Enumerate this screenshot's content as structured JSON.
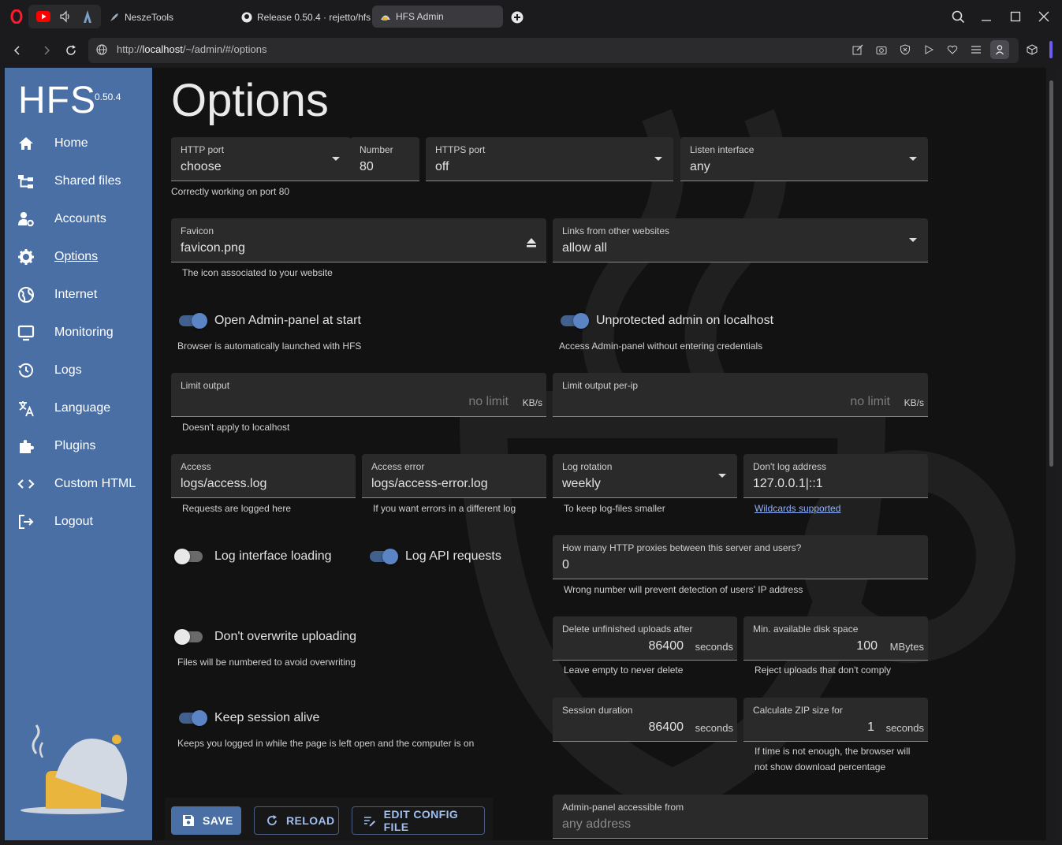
{
  "browser": {
    "tabs": [
      {
        "label": "NeszeTools"
      },
      {
        "label": "Release 0.50.4 · rejetto/hfs"
      },
      {
        "label": "HFS Admin"
      }
    ],
    "url_host": "localhost",
    "url_prefix": "http://",
    "url_path": "/~/admin/#/options"
  },
  "sidebar": {
    "brand": "HFS",
    "version": "0.50.4",
    "items": [
      {
        "label": "Home",
        "icon": "home-icon"
      },
      {
        "label": "Shared files",
        "icon": "tree-icon"
      },
      {
        "label": "Accounts",
        "icon": "user-gear-icon"
      },
      {
        "label": "Options",
        "icon": "gear-icon"
      },
      {
        "label": "Internet",
        "icon": "globe-icon"
      },
      {
        "label": "Monitoring",
        "icon": "monitor-icon"
      },
      {
        "label": "Logs",
        "icon": "history-icon"
      },
      {
        "label": "Language",
        "icon": "translate-icon"
      },
      {
        "label": "Plugins",
        "icon": "puzzle-icon"
      },
      {
        "label": "Custom HTML",
        "icon": "code-icon"
      },
      {
        "label": "Logout",
        "icon": "logout-icon"
      }
    ]
  },
  "page": {
    "title": "Options",
    "http_port": {
      "label": "HTTP port",
      "value": "choose"
    },
    "number": {
      "label": "Number",
      "value": "80"
    },
    "https_port": {
      "label": "HTTPS port",
      "value": "off"
    },
    "listen_interface": {
      "label": "Listen interface",
      "value": "any"
    },
    "port_helper": "Correctly working on port 80",
    "favicon": {
      "label": "Favicon",
      "value": "favicon.png",
      "helper": "The icon associated to your website"
    },
    "links_other": {
      "label": "Links from other websites",
      "value": "allow all"
    },
    "open_admin": {
      "label": "Open Admin-panel at start",
      "helper": "Browser is automatically launched with HFS",
      "on": true
    },
    "unprotected_admin": {
      "label": "Unprotected admin on localhost",
      "helper": "Access Admin-panel without entering credentials",
      "on": true
    },
    "limit_output": {
      "label": "Limit output",
      "placeholder": "no limit",
      "unit": "KB/s",
      "helper": "Doesn't apply to localhost"
    },
    "limit_output_ip": {
      "label": "Limit output per-ip",
      "placeholder": "no limit",
      "unit": "KB/s"
    },
    "access": {
      "label": "Access",
      "value": "logs/access.log",
      "helper": "Requests are logged here"
    },
    "access_error": {
      "label": "Access error",
      "value": "logs/access-error.log",
      "helper": "If you want errors in a different log"
    },
    "log_rotation": {
      "label": "Log rotation",
      "value": "weekly",
      "helper": "To keep log-files smaller"
    },
    "dont_log": {
      "label": "Don't log address",
      "value": "127.0.0.1|::1",
      "helper": "Wildcards supported"
    },
    "log_interface": {
      "label": "Log interface loading",
      "on": false
    },
    "log_api": {
      "label": "Log API requests",
      "on": true
    },
    "proxies": {
      "label": "How many HTTP proxies between this server and users?",
      "value": "0",
      "helper": "Wrong number will prevent detection of users' IP address"
    },
    "dont_overwrite": {
      "label": "Don't overwrite uploading",
      "helper": "Files will be numbered to avoid overwriting",
      "on": false
    },
    "delete_unfinished": {
      "label": "Delete unfinished uploads after",
      "value": "86400",
      "unit": "seconds",
      "helper": "Leave empty to never delete"
    },
    "min_disk": {
      "label": "Min. available disk space",
      "value": "100",
      "unit": "MBytes",
      "helper": "Reject uploads that don't comply"
    },
    "keep_session": {
      "label": "Keep session alive",
      "helper": "Keeps you logged in while the page is left open and the computer is on",
      "on": true
    },
    "session_duration": {
      "label": "Session duration",
      "value": "86400",
      "unit": "seconds"
    },
    "zip_size": {
      "label": "Calculate ZIP size for",
      "value": "1",
      "unit": "seconds",
      "helper1": "If time is not enough, the browser will",
      "helper2": "not show download percentage"
    },
    "admin_accessible": {
      "label": "Admin-panel accessible from",
      "value": "any address"
    },
    "buttons": {
      "save": "SAVE",
      "reload": "RELOAD",
      "edit_config": "EDIT CONFIG FILE"
    }
  }
}
